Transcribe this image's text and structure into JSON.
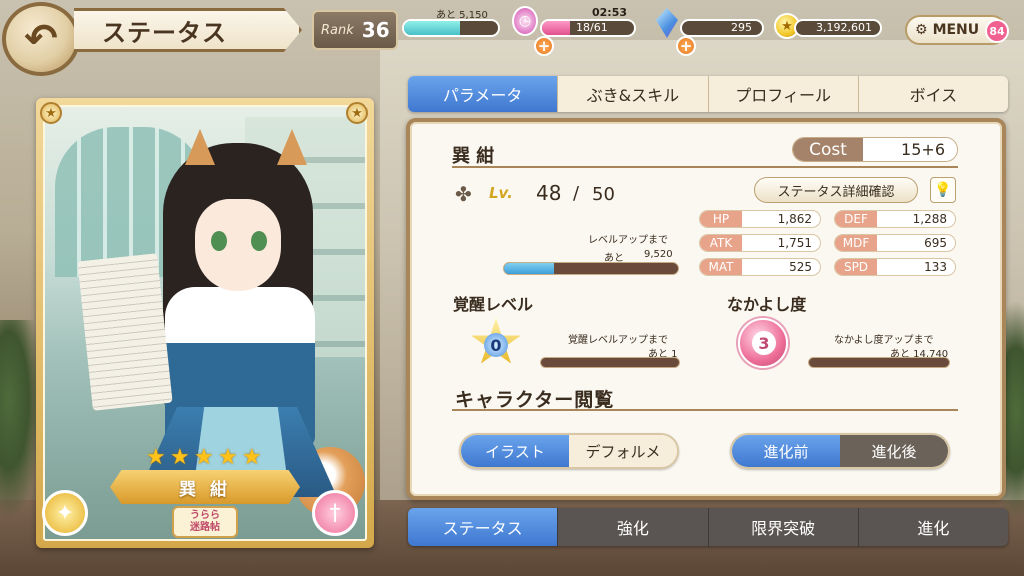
{
  "header": {
    "back_icon": "back-arrow-icon",
    "title": "ステータス",
    "rank_label": "Rank",
    "rank_value": "36",
    "rank_exp_label": "あと 5,150",
    "rank_exp_fill": 0.6,
    "stamina_timer": "02:53",
    "stamina_text": "18/61",
    "stamina_fill": 0.3,
    "gems": "295",
    "coins": "3,192,601",
    "menu_label": "MENU",
    "menu_badge": "84",
    "plus_label": "+"
  },
  "card": {
    "name": "巽 紺",
    "stars": [
      "★",
      "★",
      "★",
      "★",
      "★"
    ],
    "emblem_line1": "うらら",
    "emblem_line2": "迷路帖",
    "left_btn_icon": "✦",
    "right_btn_icon": "†"
  },
  "tabs_top": [
    "パラメータ",
    "ぶき&スキル",
    "プロフィール",
    "ボイス"
  ],
  "panel": {
    "char_name": "巽 紺",
    "cost_label": "Cost",
    "cost_value": "15+6",
    "clover_icon": "✤",
    "lv_label": "Lv.",
    "lv_current": "48",
    "lv_sep": "/",
    "lv_max": "50",
    "detail_button": "ステータス詳細確認",
    "hint_icon": "💡",
    "lvup_label": "レベルアップまで",
    "lvup_remain_label": "あと",
    "lvup_remain_value": "9,520",
    "lvup_fill": 0.29,
    "stats": [
      {
        "key": "HP",
        "value": "1,862"
      },
      {
        "key": "DEF",
        "value": "1,288"
      },
      {
        "key": "ATK",
        "value": "1,751"
      },
      {
        "key": "MDF",
        "value": "695"
      },
      {
        "key": "MAT",
        "value": "525"
      },
      {
        "key": "SPD",
        "value": "133"
      }
    ],
    "awaken_title": "覚醒レベル",
    "awaken_level": "0",
    "awaken_label": "覚醒レベルアップまで",
    "awaken_remain": "あと 1",
    "friend_title": "なかよし度",
    "friend_level": "3",
    "friend_label": "なかよし度アップまで",
    "friend_remain": "あと 14,740",
    "browse_title": "キャラクター閲覧",
    "view_toggle": {
      "on": "イラスト",
      "off": "デフォルメ"
    },
    "evo_toggle": {
      "on": "進化前",
      "off": "進化後"
    }
  },
  "tabs_bottom": [
    "ステータス",
    "強化",
    "限界突破",
    "進化"
  ],
  "colors": {
    "accent_blue": "#3f78d0",
    "gold": "#d4a620",
    "stat_key": "#e8a48a",
    "frame": "#a8865a"
  }
}
